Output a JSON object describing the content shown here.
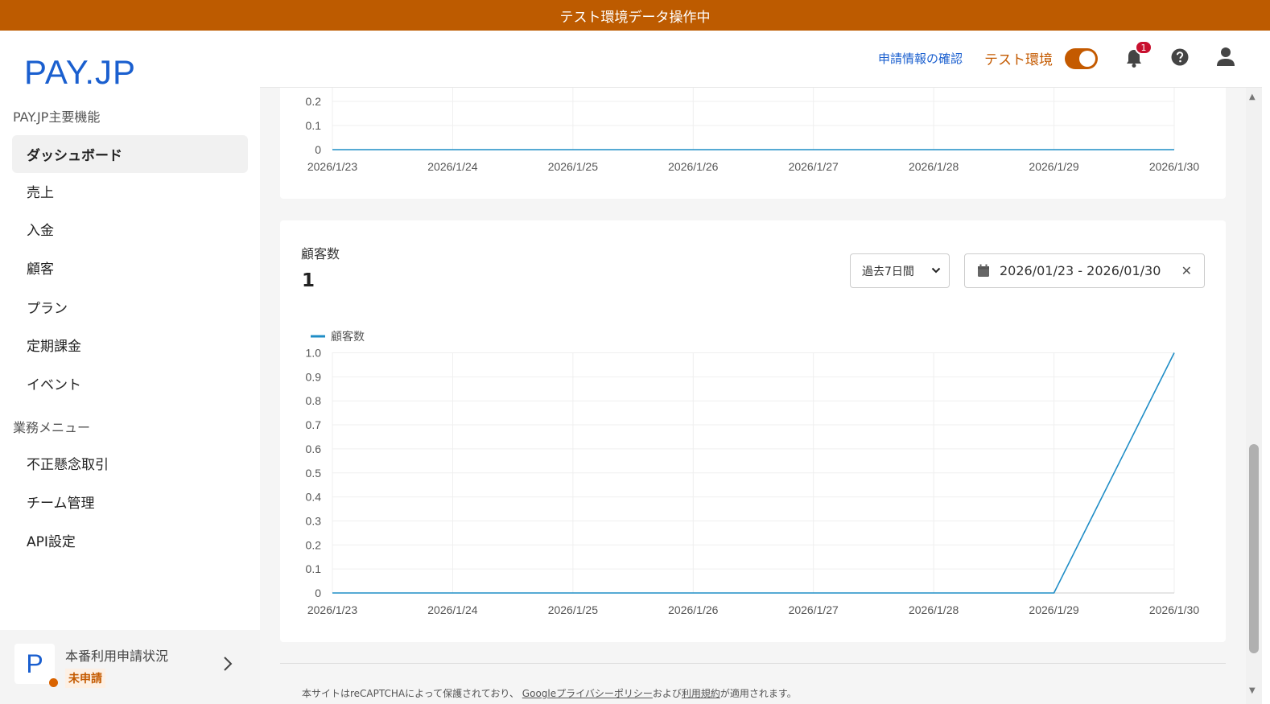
{
  "banner": {
    "text": "テスト環境データ操作中"
  },
  "logo": {
    "text": "PAY.JP"
  },
  "sidebar": {
    "main_section_label": "PAY.JP主要機能",
    "main_items": [
      {
        "label": "ダッシュボード",
        "active": true
      },
      {
        "label": "売上"
      },
      {
        "label": "入金"
      },
      {
        "label": "顧客"
      },
      {
        "label": "プラン"
      },
      {
        "label": "定期課金"
      },
      {
        "label": "イベント"
      }
    ],
    "ops_section_label": "業務メニュー",
    "ops_items": [
      {
        "label": "不正懸念取引"
      },
      {
        "label": "チーム管理"
      },
      {
        "label": "API設定"
      }
    ],
    "application_status": {
      "logo_letter": "P",
      "title": "本番利用申請状況",
      "status": "未申請"
    }
  },
  "topbar": {
    "application_link": "申請情報の確認",
    "env_label": "テスト環境",
    "test_mode_on": true,
    "notification_count": "1",
    "icons": [
      "bell-icon",
      "help-icon",
      "user-icon"
    ]
  },
  "customer_card": {
    "title": "顧客数",
    "value": "1",
    "period_select": "過去7日間",
    "date_range": "2026/01/23 - 2026/01/30"
  },
  "footer": {
    "prefix": "本サイトはreCAPTCHAによって保護されており、",
    "privacy_link": "Googleプライバシーポリシー",
    "and": "および",
    "terms_link": "利用規約",
    "suffix": "が適用されます。"
  },
  "colors": {
    "accent": "#c45a00",
    "brand": "#1a5fcf",
    "line": "#1f8dc6",
    "banner": "#bd5b00"
  },
  "chart_data": [
    {
      "type": "line",
      "categories": [
        "2026/1/23",
        "2026/1/24",
        "2026/1/25",
        "2026/1/26",
        "2026/1/27",
        "2026/1/28",
        "2026/1/29",
        "2026/1/30"
      ],
      "series": [
        {
          "values": [
            0,
            0,
            0,
            0,
            0,
            0,
            0,
            0
          ]
        }
      ],
      "y_ticks_visible": [
        "0.2",
        "0.1",
        "0"
      ],
      "grid": true
    },
    {
      "type": "line",
      "categories": [
        "2026/1/23",
        "2026/1/24",
        "2026/1/25",
        "2026/1/26",
        "2026/1/27",
        "2026/1/28",
        "2026/1/29",
        "2026/1/30"
      ],
      "series": [
        {
          "name": "顧客数",
          "values": [
            0,
            0,
            0,
            0,
            0,
            0,
            0,
            1
          ]
        }
      ],
      "y_ticks": [
        "1.0",
        "0.9",
        "0.8",
        "0.7",
        "0.6",
        "0.5",
        "0.4",
        "0.3",
        "0.2",
        "0.1",
        "0"
      ],
      "ylim": [
        0,
        1
      ],
      "legend": "top-left",
      "grid": true
    }
  ]
}
